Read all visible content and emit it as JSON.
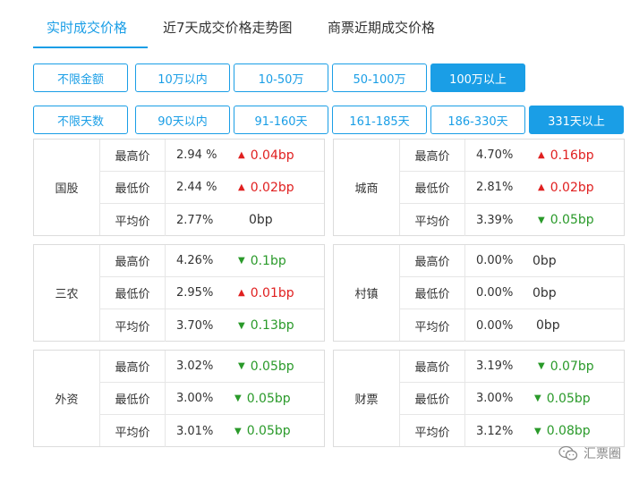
{
  "tabs": [
    "实时成交价格",
    "近7天成交价格走势图",
    "商票近期成交价格"
  ],
  "amount_filters": [
    "不限金额",
    "10万以内",
    "10-50万",
    "50-100万",
    "100万以上"
  ],
  "day_filters": [
    "不限天数",
    "90天以内",
    "91-160天",
    "161-185天",
    "186-330天",
    "331天以上"
  ],
  "colors": {
    "accent": "#1a9ee6",
    "up": "#e02020",
    "down": "#2a9a2a"
  },
  "panels": [
    {
      "category": "国股",
      "rows": [
        {
          "label": "最高价",
          "value": "2.94 %",
          "change": "0.04bp",
          "dir": "up"
        },
        {
          "label": "最低价",
          "value": "2.44 %",
          "change": "0.02bp",
          "dir": "up"
        },
        {
          "label": "平均价",
          "value": "2.77%",
          "change": "0bp",
          "dir": "flat"
        }
      ]
    },
    {
      "category": "城商",
      "rows": [
        {
          "label": "最高价",
          "value": "4.70%",
          "change": "0.16bp",
          "dir": "up"
        },
        {
          "label": "最低价",
          "value": "2.81%",
          "change": "0.02bp",
          "dir": "up"
        },
        {
          "label": "平均价",
          "value": "3.39%",
          "change": "0.05bp",
          "dir": "down"
        }
      ]
    },
    {
      "category": "三农",
      "rows": [
        {
          "label": "最高价",
          "value": "4.26%",
          "change": "0.1bp",
          "dir": "down"
        },
        {
          "label": "最低价",
          "value": "2.95%",
          "change": "0.01bp",
          "dir": "up"
        },
        {
          "label": "平均价",
          "value": "3.70%",
          "change": "0.13bp",
          "dir": "down"
        }
      ]
    },
    {
      "category": "村镇",
      "rows": [
        {
          "label": "最高价",
          "value": "0.00%",
          "change": "0bp",
          "dir": "flat"
        },
        {
          "label": "最低价",
          "value": "0.00%",
          "change": "0bp",
          "dir": "flat"
        },
        {
          "label": "平均价",
          "value": "0.00%",
          "change": "0bp",
          "dir": "flat"
        }
      ]
    },
    {
      "category": "外资",
      "rows": [
        {
          "label": "最高价",
          "value": "3.02%",
          "change": "0.05bp",
          "dir": "down"
        },
        {
          "label": "最低价",
          "value": "3.00%",
          "change": "0.05bp",
          "dir": "down"
        },
        {
          "label": "平均价",
          "value": "3.01%",
          "change": "0.05bp",
          "dir": "down"
        }
      ]
    },
    {
      "category": "财票",
      "rows": [
        {
          "label": "最高价",
          "value": "3.19%",
          "change": "0.07bp",
          "dir": "down"
        },
        {
          "label": "最低价",
          "value": "3.00%",
          "change": "0.05bp",
          "dir": "down"
        },
        {
          "label": "平均价",
          "value": "3.12%",
          "change": "0.08bp",
          "dir": "down"
        }
      ]
    }
  ],
  "watermark": {
    "text": "汇票圈",
    "icon": "wechat-icon"
  }
}
